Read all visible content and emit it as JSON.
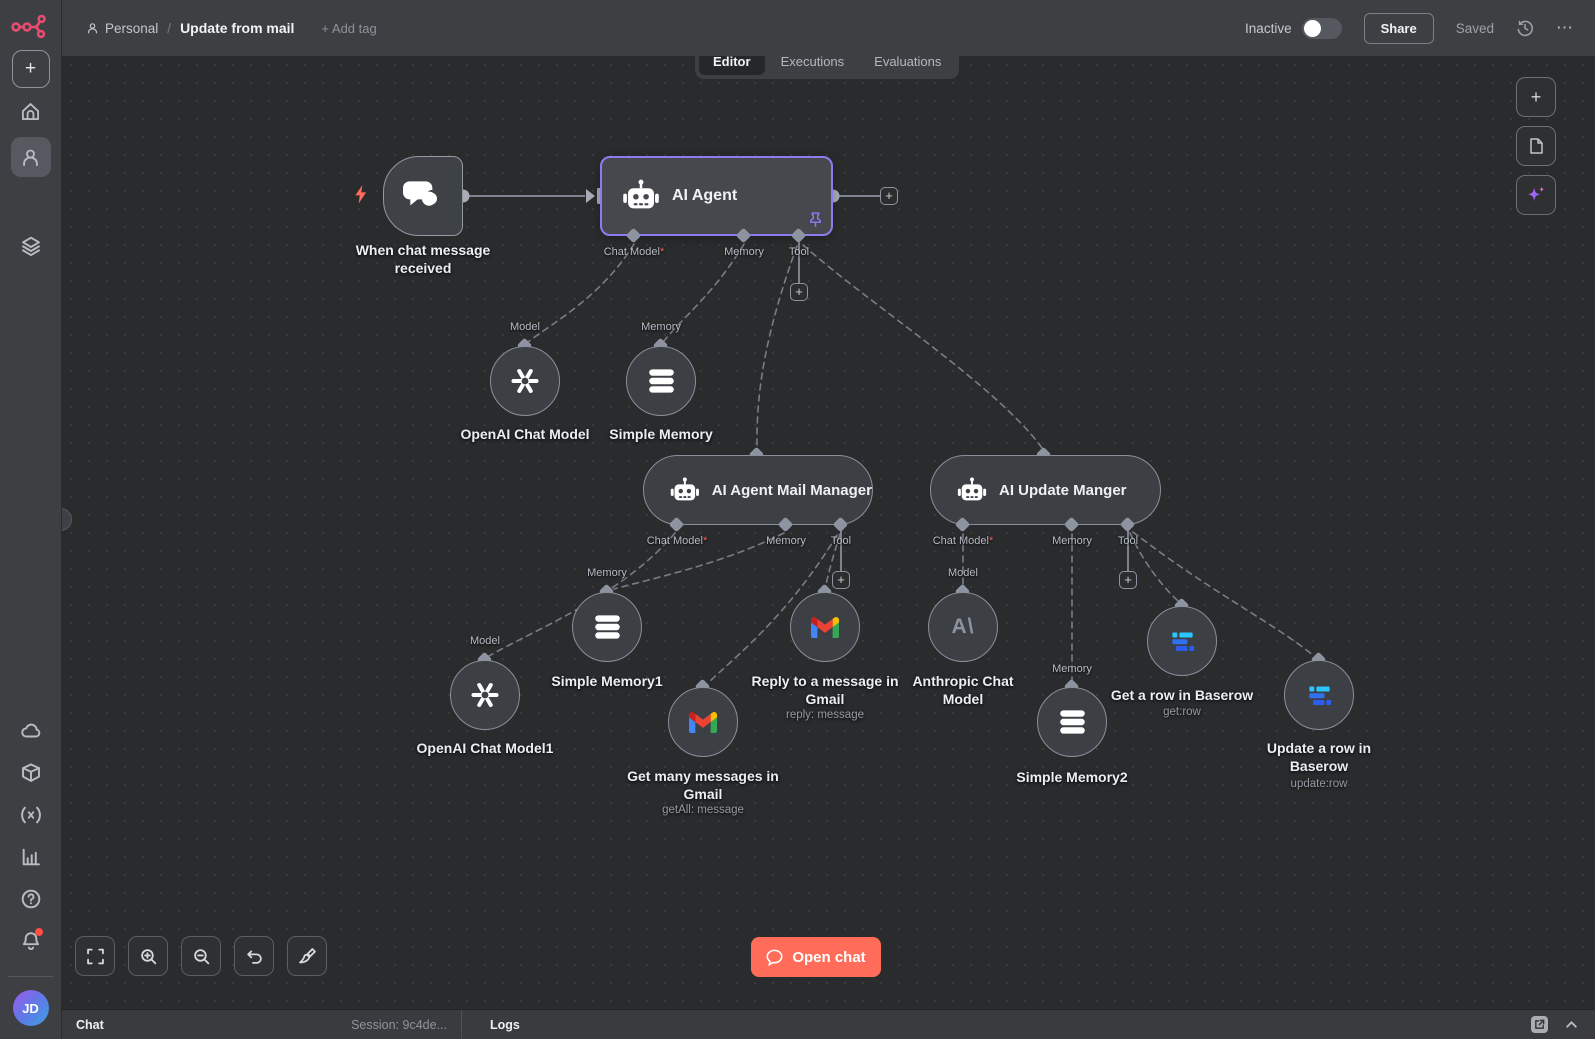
{
  "header": {
    "project": "Personal",
    "separator": "/",
    "workflow_title": "Update from mail",
    "add_tag": "+ Add tag",
    "activation_label": "Inactive",
    "share": "Share",
    "saved": "Saved"
  },
  "tabs": {
    "editor": "Editor",
    "executions": "Executions",
    "evaluations": "Evaluations"
  },
  "ports": {
    "chat_model": "Chat Model",
    "required": "*",
    "memory": "Memory",
    "tool": "Tool",
    "model": "Model"
  },
  "nodes": {
    "trigger": {
      "label": "When chat message received"
    },
    "ai_agent": {
      "label": "AI Agent"
    },
    "mail_agent": {
      "label": "AI Agent Mail Manager"
    },
    "update_agent": {
      "label": "AI Update Manger"
    },
    "openai": {
      "label": "OpenAI Chat Model"
    },
    "simple_memory": {
      "label": "Simple Memory"
    },
    "openai1": {
      "label": "OpenAI Chat Model1"
    },
    "simple_memory1": {
      "label": "Simple Memory1"
    },
    "gmail_get": {
      "label": "Get many messages in Gmail",
      "subtitle": "getAll: message"
    },
    "gmail_reply": {
      "label": "Reply to a message in Gmail",
      "subtitle": "reply: message"
    },
    "anthropic": {
      "label": "Anthropic Chat Model",
      "icon_text": "A\\"
    },
    "simple_memory2": {
      "label": "Simple Memory2"
    },
    "baserow_get": {
      "label": "Get a row in Baserow",
      "subtitle": "get:row"
    },
    "baserow_update": {
      "label": "Update a row in Baserow",
      "subtitle": "update:row"
    }
  },
  "controls": {
    "open_chat": "Open chat"
  },
  "status_bar": {
    "chat": "Chat",
    "session": "Session: 9c4de...",
    "logs": "Logs"
  },
  "user": {
    "initials": "JD"
  },
  "colors": {
    "accent": "#ff6d5a",
    "brand": "#ea4b71",
    "selection": "#8d7cf0"
  }
}
